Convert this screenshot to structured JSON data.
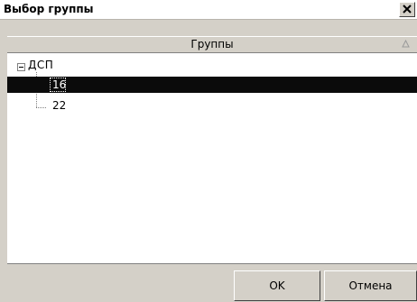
{
  "window": {
    "title": "Выбор группы",
    "close_label": "×"
  },
  "grid": {
    "column_header": "Группы",
    "sort_icon": "sort-asc-icon"
  },
  "tree": {
    "root": {
      "label": "ДСП",
      "expanded": true,
      "children": [
        {
          "label": "16",
          "selected": true
        },
        {
          "label": "22",
          "selected": false
        }
      ]
    }
  },
  "buttons": {
    "ok_label": "OK",
    "cancel_label": "Отмена"
  },
  "colors": {
    "selection_bg": "#0b0b0b",
    "selection_fg": "#ffffff",
    "window_bg": "#d4d0c8"
  }
}
